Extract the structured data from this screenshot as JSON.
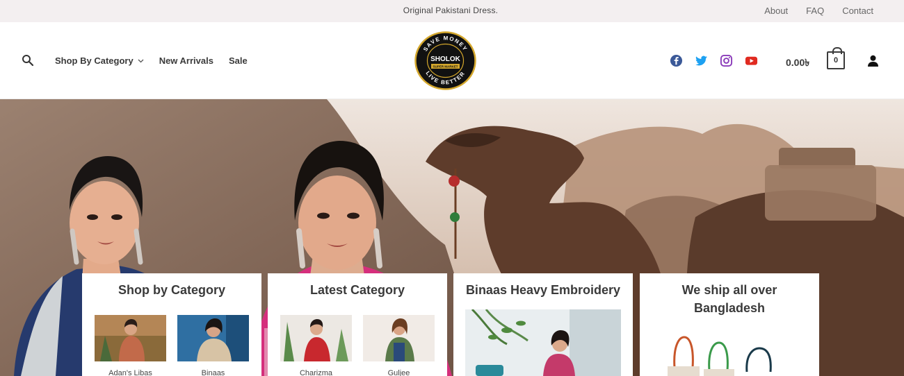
{
  "topbar": {
    "promo": "Original Pakistani Dress.",
    "links": [
      "About",
      "FAQ",
      "Contact"
    ]
  },
  "header": {
    "nav": [
      "Shop By Category",
      "New Arrivals",
      "Sale"
    ],
    "logo": {
      "top_text": "SAVE MONEY",
      "name": "SHOLOK",
      "sub": "SUPER MARKET",
      "bottom_text": "LIVE BETTER"
    },
    "socials": [
      "facebook-icon",
      "twitter-icon",
      "instagram-icon",
      "youtube-icon"
    ],
    "cart_total": "0.00৳",
    "cart_count": "0"
  },
  "cards": [
    {
      "title": "Shop by Category",
      "items": [
        "Adan's Libas",
        "Binaas"
      ]
    },
    {
      "title": "Latest Category",
      "items": [
        "Charizma",
        "Guljee"
      ]
    },
    {
      "title": "Binaas Heavy Embroidery"
    },
    {
      "title": "We ship all over Bangladesh"
    }
  ],
  "colors": {
    "topbar_bg": "#f3eff0",
    "facebook": "#3b5998",
    "twitter": "#1da1f2",
    "instagram": "#8a3ab9",
    "youtube": "#e02a20",
    "logo_gold": "#d4a72c"
  }
}
